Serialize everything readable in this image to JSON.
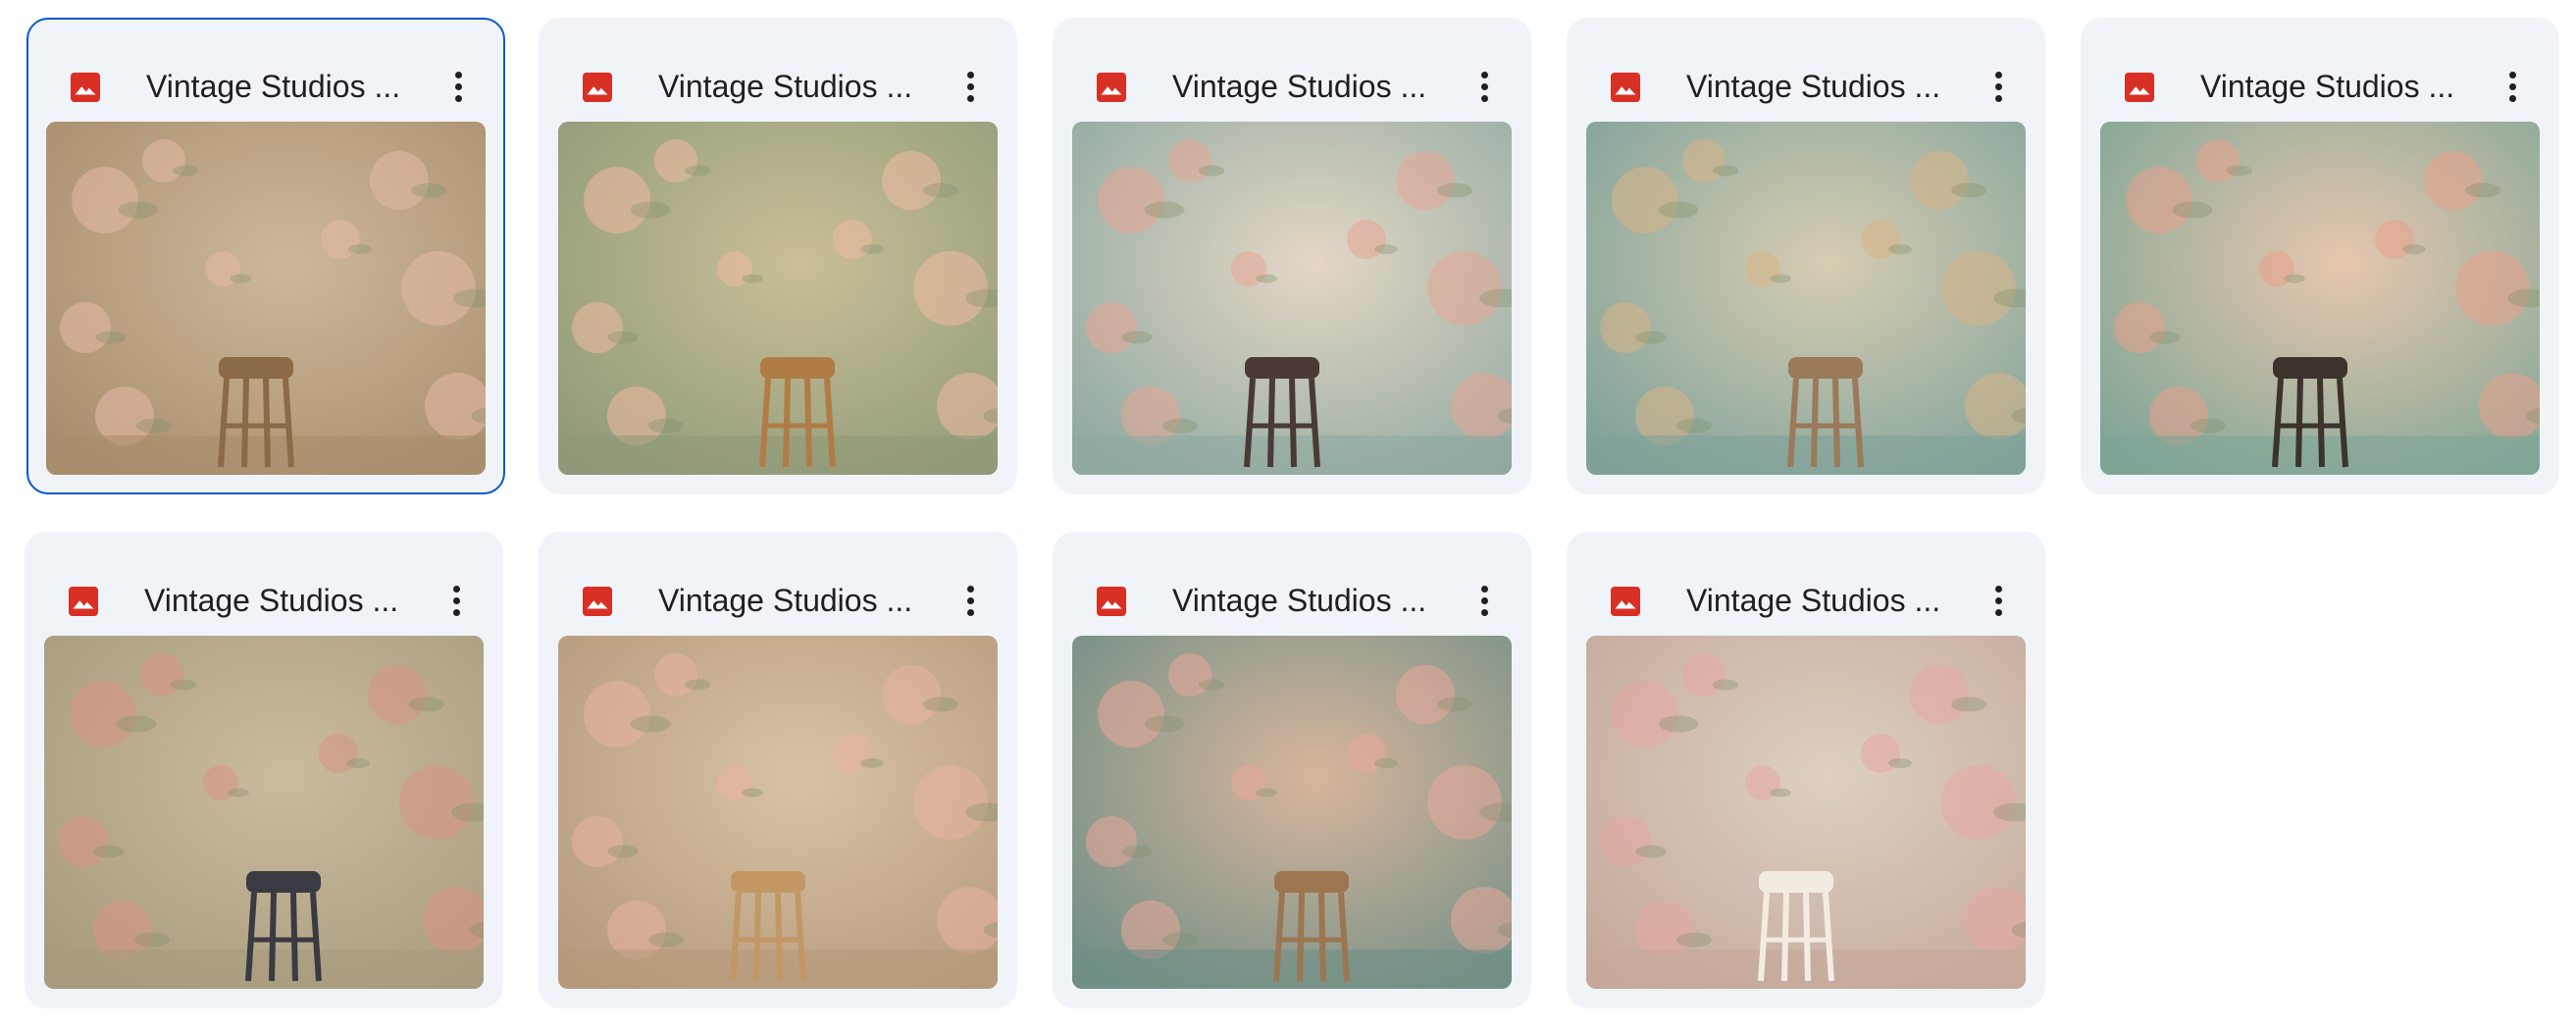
{
  "files": [
    {
      "title": "Vintage Studios ...",
      "icon": "image-file-icon",
      "selected": true,
      "colors": {
        "bg1": "#cdb89a",
        "bg2": "#a88d6c",
        "accent": "#e6b9a8",
        "stool": "#8a6a47"
      }
    },
    {
      "title": "Vintage Studios ...",
      "icon": "image-file-icon",
      "selected": false,
      "colors": {
        "bg1": "#c9bf98",
        "bg2": "#8f9a78",
        "accent": "#f0b9a2",
        "stool": "#b07c45"
      }
    },
    {
      "title": "Vintage Studios ...",
      "icon": "image-file-icon",
      "selected": false,
      "colors": {
        "bg1": "#e4d7c6",
        "bg2": "#8fa9a0",
        "accent": "#e7a596",
        "stool": "#4a3a35"
      }
    },
    {
      "title": "Vintage Studios ...",
      "icon": "image-file-icon",
      "selected": false,
      "colors": {
        "bg1": "#d7cdb2",
        "bg2": "#7fa19a",
        "accent": "#d9b487",
        "stool": "#9a7a58"
      }
    },
    {
      "title": "Vintage Studios ...",
      "icon": "image-file-icon",
      "selected": false,
      "colors": {
        "bg1": "#e7c7ae",
        "bg2": "#7ea596",
        "accent": "#e9a08c",
        "stool": "#3c332c"
      }
    },
    {
      "title": "Vintage Studios ...",
      "icon": "image-file-icon",
      "selected": false,
      "colors": {
        "bg1": "#cbbb9f",
        "bg2": "#a89b7d",
        "accent": "#d99484",
        "stool": "#3a3a42"
      }
    },
    {
      "title": "Vintage Studios ...",
      "icon": "image-file-icon",
      "selected": false,
      "colors": {
        "bg1": "#d9c2a5",
        "bg2": "#b59a7c",
        "accent": "#e9b3a3",
        "stool": "#c39764"
      }
    },
    {
      "title": "Vintage Studios ...",
      "icon": "image-file-icon",
      "selected": false,
      "colors": {
        "bg1": "#d8b59c",
        "bg2": "#6f8f86",
        "accent": "#e9a79a",
        "stool": "#9b7651"
      }
    },
    {
      "title": "Vintage Studios ...",
      "icon": "image-file-icon",
      "selected": false,
      "colors": {
        "bg1": "#ddd0c4",
        "bg2": "#c5a99a",
        "accent": "#e8a8a2",
        "stool": "#f2ece2"
      }
    }
  ],
  "more_icon": "more-vert-icon"
}
